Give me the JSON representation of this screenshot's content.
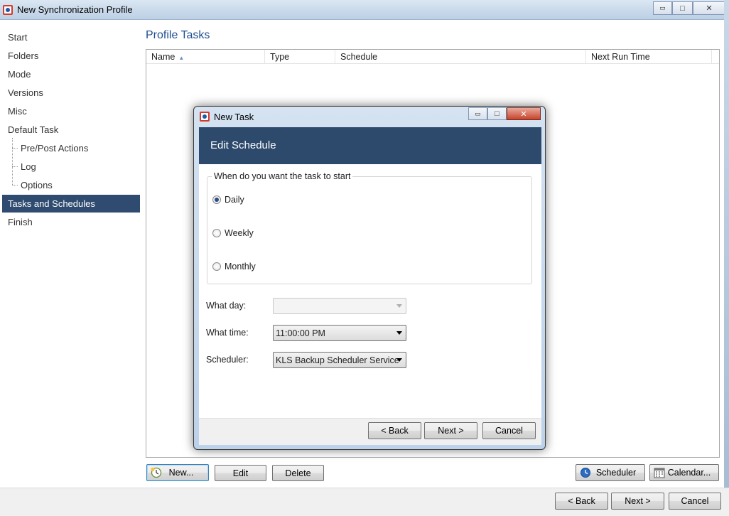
{
  "window": {
    "title": "New Synchronization Profile",
    "controls": {
      "minimize": "▭",
      "maximize": "□",
      "close": "✕"
    }
  },
  "sidebar": {
    "items": [
      {
        "label": "Start",
        "level": 0
      },
      {
        "label": "Folders",
        "level": 0
      },
      {
        "label": "Mode",
        "level": 0
      },
      {
        "label": "Versions",
        "level": 0
      },
      {
        "label": "Misc",
        "level": 0
      },
      {
        "label": "Default Task",
        "level": 0
      },
      {
        "label": "Pre/Post Actions",
        "level": 1
      },
      {
        "label": "Log",
        "level": 1
      },
      {
        "label": "Options",
        "level": 1
      },
      {
        "label": "Tasks and Schedules",
        "level": 0,
        "selected": true
      },
      {
        "label": "Finish",
        "level": 0
      }
    ]
  },
  "main": {
    "title": "Profile Tasks",
    "columns": [
      "Name",
      "Type",
      "Schedule",
      "Next Run Time"
    ],
    "sort_column": "Name",
    "sort_direction": "ascending",
    "rows": [],
    "buttons": {
      "new": "New...",
      "edit": "Edit",
      "delete": "Delete",
      "scheduler": "Scheduler",
      "calendar": "Calendar..."
    }
  },
  "footer": {
    "back": "< Back",
    "next": "Next >",
    "cancel": "Cancel"
  },
  "dialog": {
    "title": "New Task",
    "header": "Edit Schedule",
    "group_label": "When do you want the task to start",
    "options": [
      {
        "label": "Daily",
        "checked": true
      },
      {
        "label": "Weekly",
        "checked": false
      },
      {
        "label": "Monthly",
        "checked": false
      }
    ],
    "what_day": {
      "label": "What day:",
      "value": "",
      "enabled": false
    },
    "what_time": {
      "label": "What time:",
      "value": "11:00:00 PM"
    },
    "scheduler": {
      "label": "Scheduler:",
      "value": "KLS Backup Scheduler Service"
    },
    "buttons": {
      "back": "< Back",
      "next": "Next >",
      "cancel": "Cancel"
    }
  },
  "colors": {
    "selection": "#2f4c70",
    "dialog_header": "#2d4a6d",
    "heading_text": "#1f4f91"
  },
  "icons": {
    "app": "app-icon",
    "new_task": "clock-plus-icon",
    "scheduler": "clock-icon",
    "calendar": "calendar-icon"
  }
}
